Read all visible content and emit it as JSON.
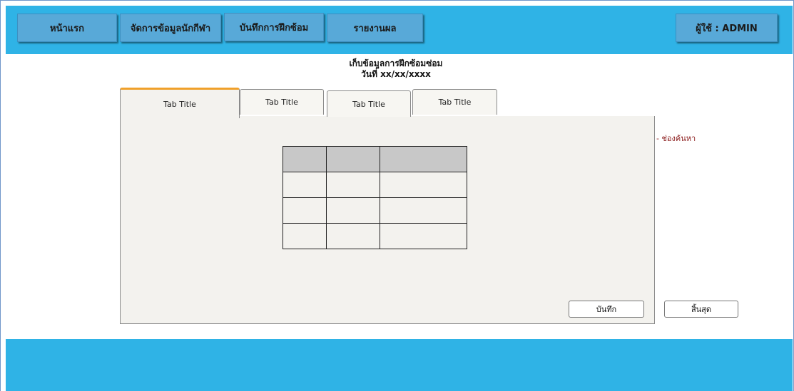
{
  "nav": {
    "home_label": "หน้าแรก",
    "athletes_label": "จัดการข้อมูลนักกีฬา",
    "training_label": "บันทึกการฝึกซ้อม",
    "report_label": "รายงานผล",
    "user_label": "ผู้ใช้ : ADMIN"
  },
  "header": {
    "title": "เก็บข้อมูลการฝึกซ้อมซ่อม",
    "date": "วันที่ xx/xx/xxxx"
  },
  "tabs": [
    {
      "label": "Tab Title",
      "active": true
    },
    {
      "label": "Tab Title",
      "active": false
    },
    {
      "label": "Tab Title",
      "active": false
    },
    {
      "label": "Tab Title",
      "active": false
    }
  ],
  "table": {
    "columns": 3,
    "body_rows": 3
  },
  "side_note": "- ช่องค้นหา",
  "buttons": {
    "save_label": "บันทึก",
    "finish_label": "สิ้นสุด"
  },
  "colors": {
    "bar": "#2fb3e6",
    "nav_button": "#58a9d8",
    "active_tab_accent": "#f0a02a",
    "panel_bg": "#f3f2ee",
    "note_text": "#8b1c1c"
  }
}
